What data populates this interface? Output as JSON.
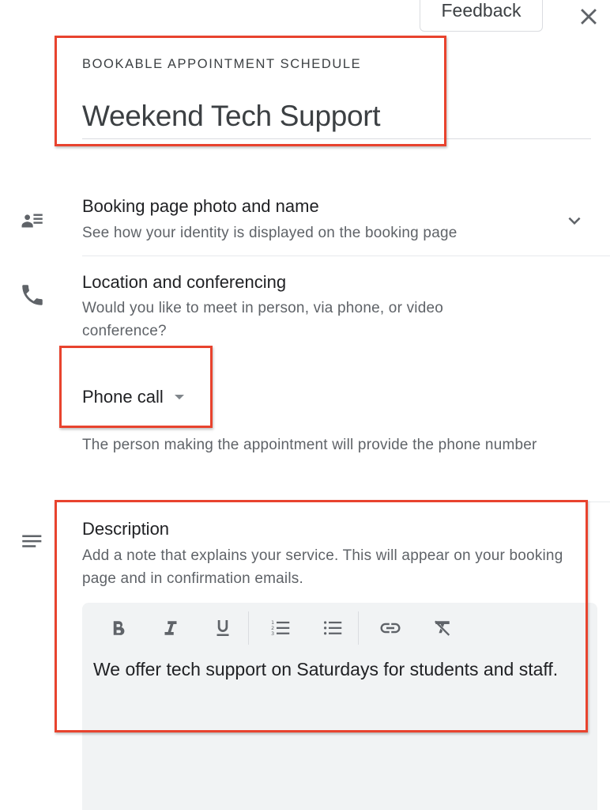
{
  "header": {
    "feedback_label": "Feedback",
    "close_icon": "close-icon"
  },
  "schedule": {
    "eyebrow": "BOOKABLE APPOINTMENT SCHEDULE",
    "title": "Weekend Tech Support"
  },
  "sections": {
    "booking_page": {
      "icon": "contact-list-icon",
      "title": "Booking page photo and name",
      "subtitle": "See how your identity is displayed on the booking page",
      "expand_icon": "chevron-down-icon"
    },
    "location": {
      "icon": "phone-icon",
      "title": "Location and conferencing",
      "subtitle": "Would you like to meet in person, via phone, or video conference?",
      "select_value": "Phone call",
      "helper": "The person making the appointment will provide the phone number"
    },
    "description": {
      "icon": "notes-icon",
      "title": "Description",
      "subtitle": "Add a note that explains your service. This will appear on your booking page and in confirmation emails.",
      "toolbar": [
        "bold",
        "italic",
        "underline",
        "numbered-list",
        "bulleted-list",
        "link",
        "clear-formatting"
      ],
      "content": "We offer tech support on Saturdays for students and staff."
    }
  },
  "colors": {
    "highlight": "#e8432e",
    "editor_bg": "#f1f3f4",
    "icon_gray": "#5f6368"
  }
}
